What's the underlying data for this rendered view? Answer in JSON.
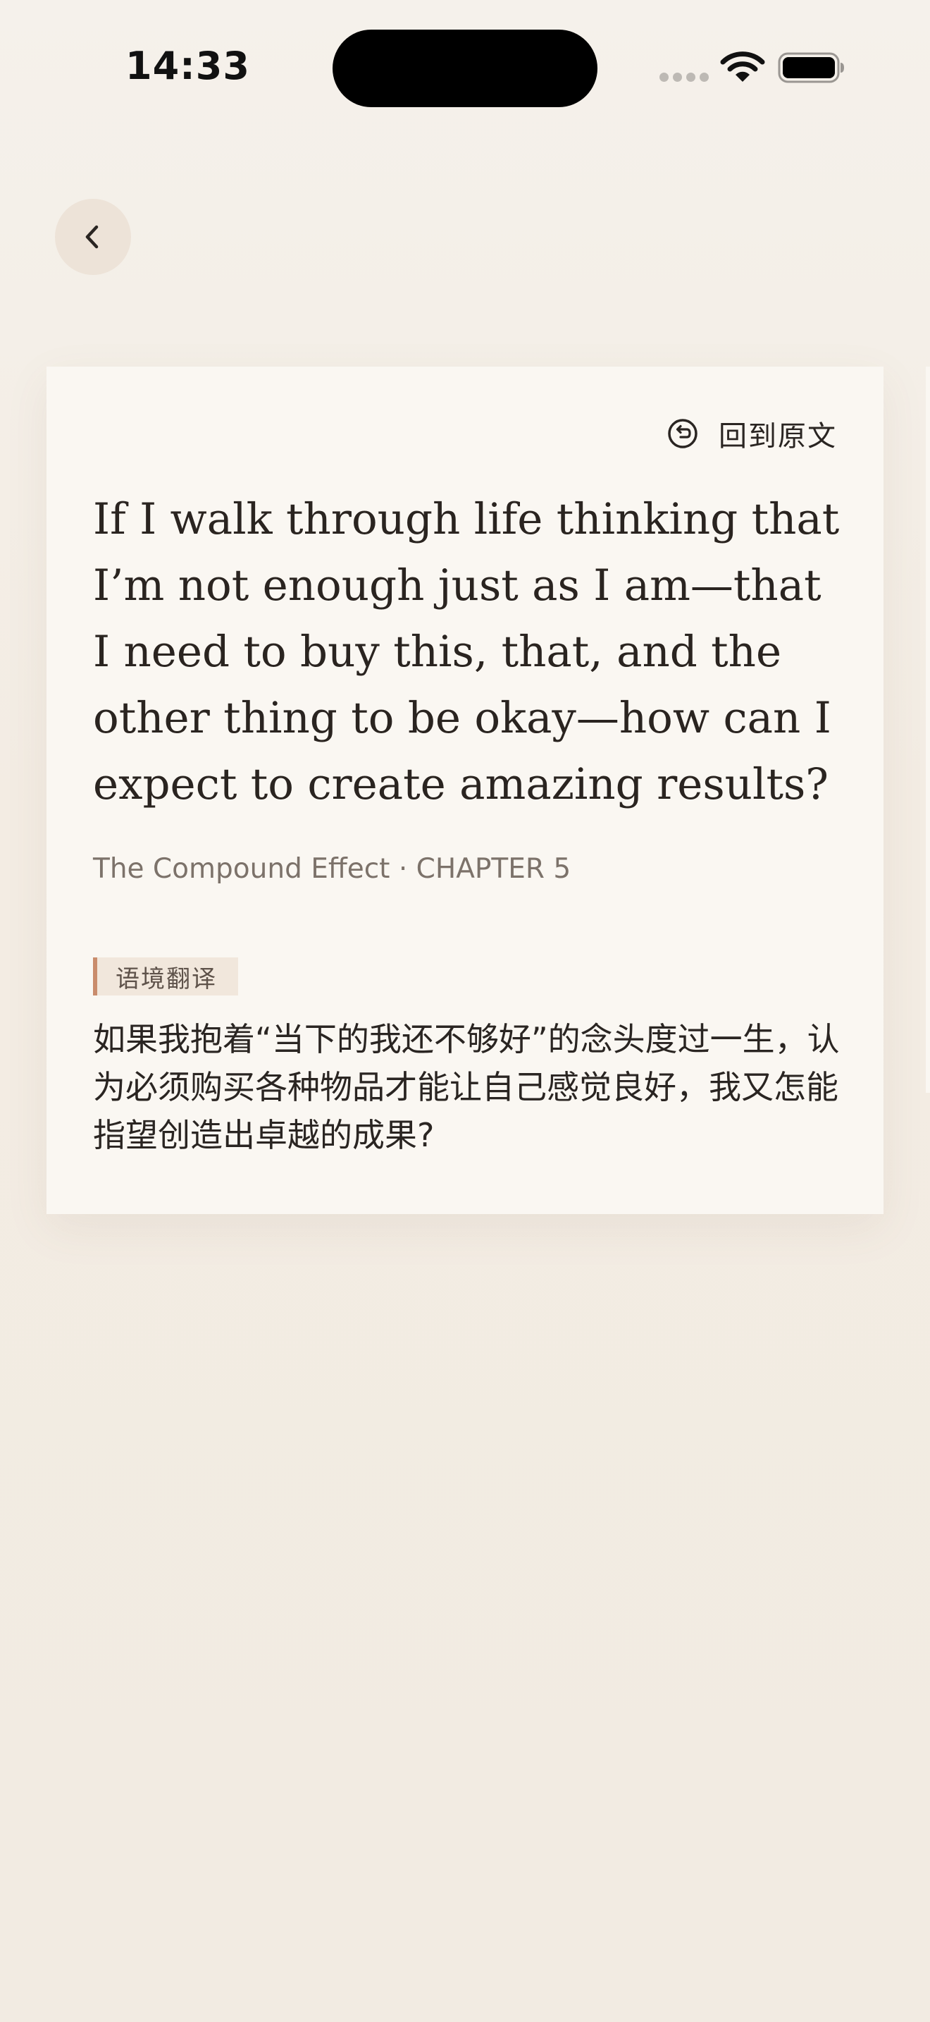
{
  "status_bar": {
    "time": "14:33"
  },
  "navigation": {
    "back_icon": "chevron-left-icon"
  },
  "card": {
    "back_to_original_label": "回到原文",
    "back_to_original_icon": "undo-icon",
    "quote": "If I walk through life thinking that I’m not enough just as I am—that I need to buy this, that, and the other thing to be okay—how can I expect to create amazing results?",
    "source": "The Compound Effect · CHAPTER 5",
    "tag_label": "语境翻译",
    "translation": "如果我抱着“当下的我还不够好”的念头度过一生，认为必须购买各种物品才能让自己感觉良好，我又怎能指望创造出卓越的成果?"
  },
  "colors": {
    "background": "#f3ece3",
    "card": "#faf7f2",
    "accent": "#c98c6c",
    "tag_bg": "#f1e7dc"
  }
}
